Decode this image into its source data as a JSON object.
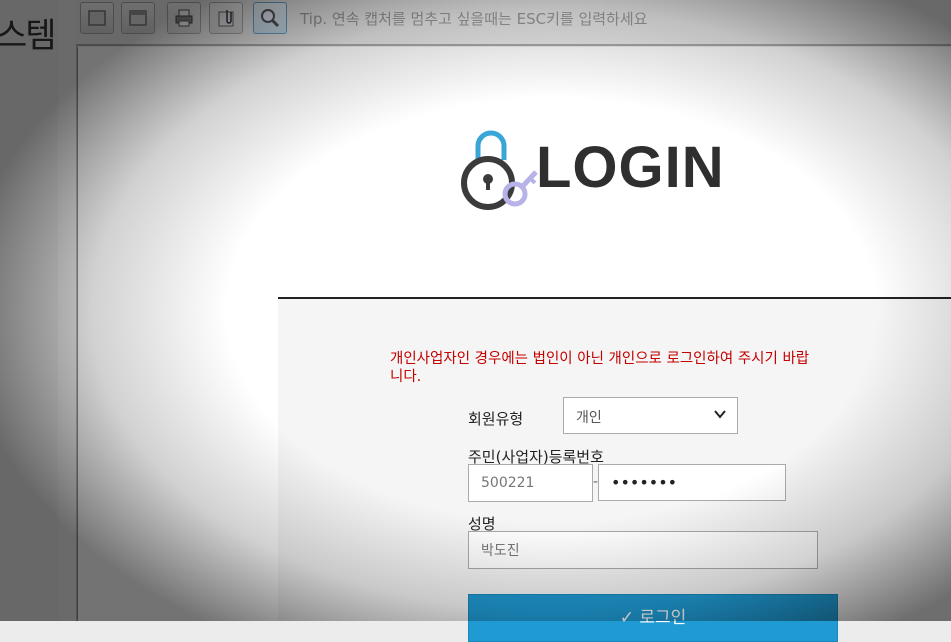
{
  "background_text": "스템",
  "toolbar": {
    "buttons": [
      {
        "name": "capture-area-icon"
      },
      {
        "name": "capture-window-icon"
      },
      {
        "name": "print-icon"
      },
      {
        "name": "clip-icon"
      },
      {
        "name": "zoom-icon"
      }
    ],
    "tip": "Tip. 연속 캡처를 멈추고 싶을때는 ESC키를 입력하세요"
  },
  "logo": {
    "text": "LOGIN"
  },
  "form": {
    "notice": "개인사업자인 경우에는 법인이 아닌 개인으로 로그인하여 주시기 바랍니다.",
    "member_type_label": "회원유형",
    "member_type_value": "개인",
    "id_label": "주민(사업자)등록번호",
    "id_first_value": "500221",
    "id_separator": "-",
    "id_second_value": "•••••••",
    "name_label": "성명",
    "name_value": "박도진",
    "login_button": "✓ 로그인"
  },
  "colors": {
    "notice": "#c40000",
    "login_button": "#1f9ad3",
    "lock_shackle": "#3aa6d8",
    "key": "#b7b2e8"
  }
}
